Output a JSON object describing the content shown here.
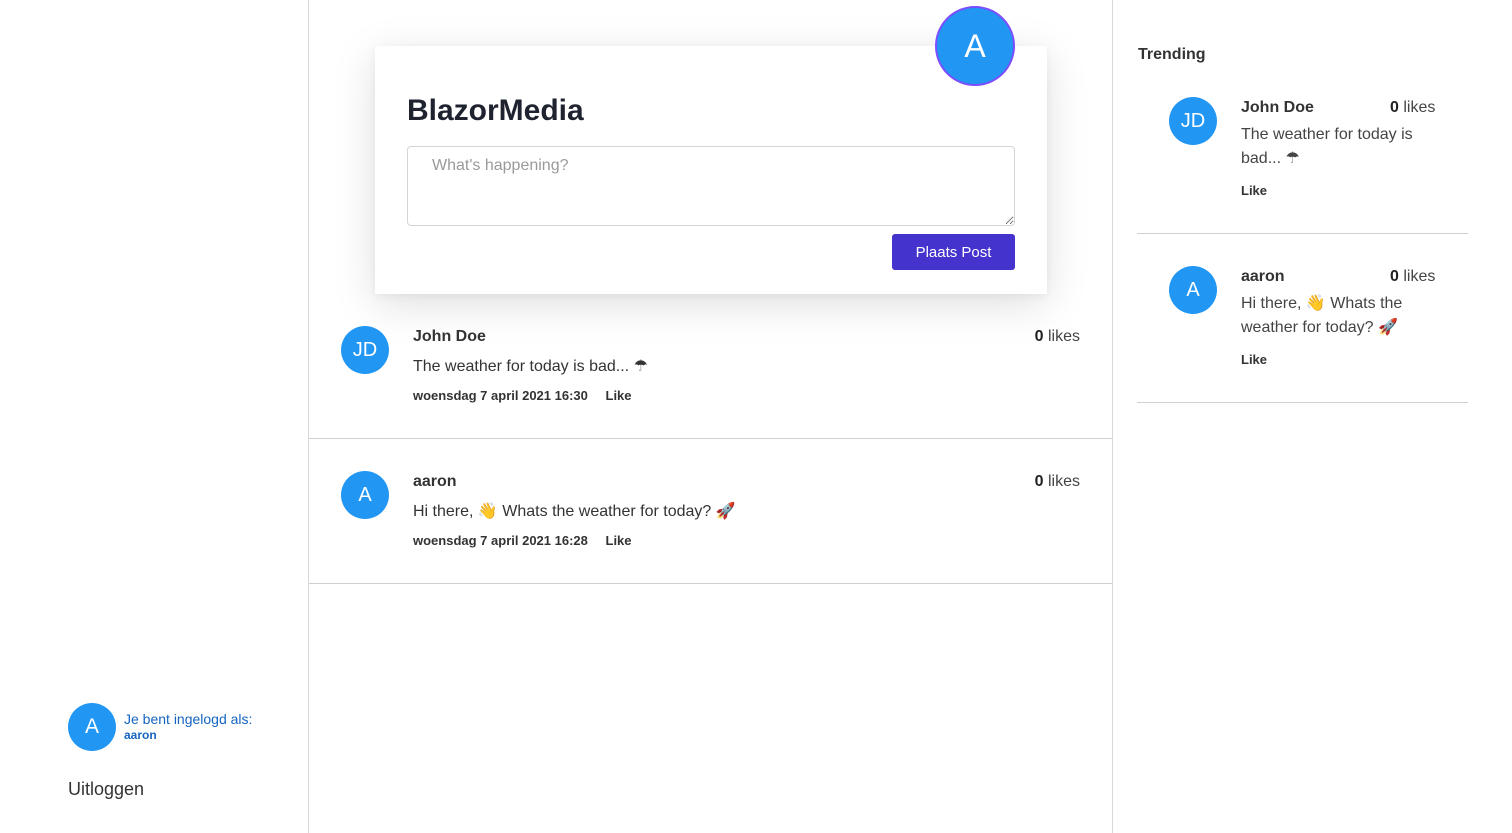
{
  "composer": {
    "avatar_initial": "A",
    "title": "BlazorMedia",
    "placeholder": "What's happening?",
    "post_button": "Plaats Post"
  },
  "posts": [
    {
      "initials": "JD",
      "author": "John Doe",
      "likes_count": "0",
      "likes_label": "likes",
      "text": "The weather for today is bad... ☂",
      "timestamp": "woensdag 7 april 2021 16:30",
      "like_label": "Like"
    },
    {
      "initials": "A",
      "author": "aaron",
      "likes_count": "0",
      "likes_label": "likes",
      "text": "Hi there, 👋 Whats the weather for today? 🚀",
      "timestamp": "woensdag 7 april 2021 16:28",
      "like_label": "Like"
    }
  ],
  "trending": {
    "title": "Trending",
    "items": [
      {
        "initials": "JD",
        "author": "John Doe",
        "likes_count": "0",
        "likes_label": "likes",
        "text": "The weather for today is bad... ☂",
        "like_label": "Like"
      },
      {
        "initials": "A",
        "author": "aaron",
        "likes_count": "0",
        "likes_label": "likes",
        "text": "Hi there, 👋 Whats the weather for today? 🚀",
        "like_label": "Like"
      }
    ]
  },
  "sidebar": {
    "avatar_initial": "A",
    "login_label": "Je bent ingelogd als:",
    "username": "aaron",
    "logout_label": "Uitloggen"
  },
  "colors": {
    "avatar_bg": "#2196f3",
    "button_bg": "#4433cc",
    "login_text": "#1565c0"
  }
}
